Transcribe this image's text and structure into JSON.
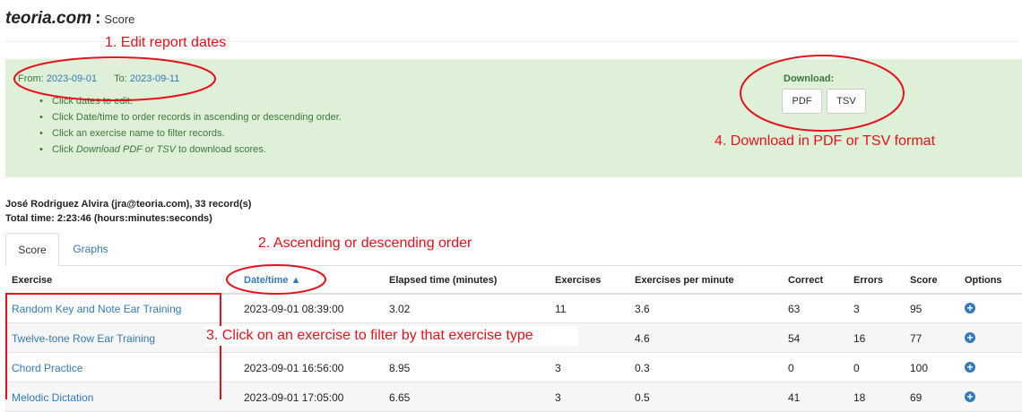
{
  "header": {
    "site": "teoria.com",
    "separator": ":",
    "page": "Score"
  },
  "panel": {
    "from_label": "From:",
    "from_date": "2023-09-01",
    "to_label": "To:",
    "to_date": "2023-09-11",
    "instructions": [
      "Click dates to edit.",
      "Click Date/time to order records in ascending or descending order.",
      "Click an exercise name to filter records.",
      "Click Download PDF or TSV to download scores."
    ],
    "download_label": "Download:",
    "pdf_label": "PDF",
    "tsv_label": "TSV"
  },
  "annotations": {
    "a1": "1. Edit report dates",
    "a2": "2. Ascending or descending order",
    "a3": "3. Click on an exercise to filter by that exercise type",
    "a4": "4. Download in PDF or TSV format"
  },
  "user": {
    "line1": "José Rodriguez Alvira (jra@teoria.com), 33 record(s)",
    "line2": "Total time: 2:23:46 (hours:minutes:seconds)"
  },
  "tabs": {
    "score": "Score",
    "graphs": "Graphs"
  },
  "table": {
    "headers": {
      "exercise": "Exercise",
      "datetime": "Date/time ▲",
      "elapsed": "Elapsed time (minutes)",
      "exercises": "Exercises",
      "epm": "Exercises per minute",
      "correct": "Correct",
      "errors": "Errors",
      "score": "Score",
      "options": "Options"
    },
    "rows": [
      {
        "exercise": "Random Key and Note Ear Training",
        "datetime": "2023-09-01 08:39:00",
        "elapsed": "3.02",
        "exercises": "11",
        "epm": "3.6",
        "correct": "63",
        "errors": "3",
        "score": "95"
      },
      {
        "exercise": "Twelve-tone Row Ear Training",
        "datetime": "",
        "elapsed": "",
        "exercises": "",
        "epm": "4.6",
        "correct": "54",
        "errors": "16",
        "score": "77"
      },
      {
        "exercise": "Chord Practice",
        "datetime": "2023-09-01 16:56:00",
        "elapsed": "8.95",
        "exercises": "3",
        "epm": "0.3",
        "correct": "0",
        "errors": "0",
        "score": "100"
      },
      {
        "exercise": "Melodic Dictation",
        "datetime": "2023-09-01 17:05:00",
        "elapsed": "6.65",
        "exercises": "3",
        "epm": "0.5",
        "correct": "41",
        "errors": "18",
        "score": "69"
      }
    ]
  },
  "colors": {
    "accent": "#337ab7",
    "panel_bg": "#dff0d8",
    "annotation": "#e8101a"
  },
  "icons": {
    "option": "plus-circle-icon"
  }
}
